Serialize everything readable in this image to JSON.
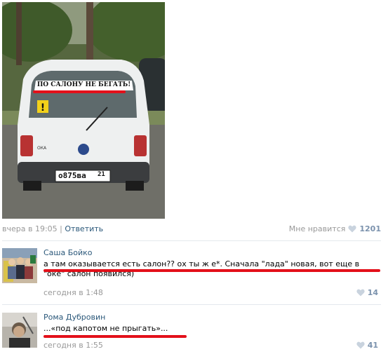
{
  "post": {
    "photo": {
      "windshield_sign": "ПО САЛОНУ НЕ БЕГАТЬ!",
      "plate_number": "о875ва",
      "plate_region": "21",
      "model_badge": "ОКА"
    },
    "time": "вчера в 19:05",
    "separator": "|",
    "reply_label": "Ответить",
    "like_label": "Мне нравится",
    "like_count": "1201"
  },
  "comments": [
    {
      "author": "Саша Бойко",
      "text": "а там оказывается есть салон?? ох ты ж е*. Сначала \"лада\" новая, вот еще в \"оке\" салон появился)",
      "time": "сегодня в 1:48",
      "likes": "14"
    },
    {
      "author": "Рома Дубровин",
      "text": "...«под капотом не прыгать»...",
      "time": "сегодня в 1:55",
      "likes": "41"
    }
  ],
  "colors": {
    "link": "#2b587a",
    "muted": "#999999",
    "like_count": "#7b92ad",
    "underline": "#e3101a"
  }
}
